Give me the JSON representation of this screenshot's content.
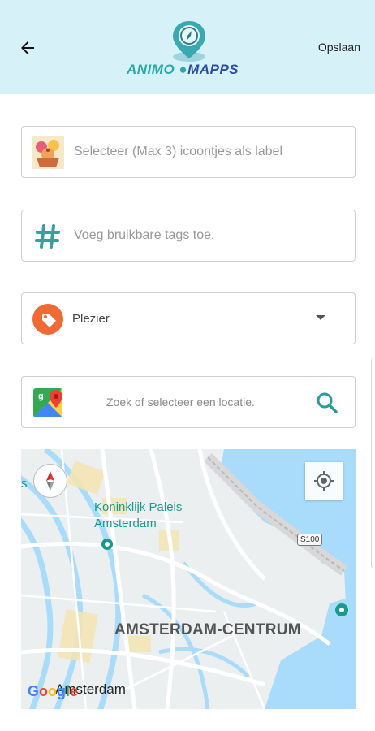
{
  "header": {
    "save_label": "Opslaan",
    "logo_text_part1": "ANIMO",
    "logo_text_part2": "MAPPS"
  },
  "form": {
    "icons_field": {
      "placeholder": "Selecteer (Max 3) icoontjes als label",
      "icon": "cupcake-icon"
    },
    "tags_field": {
      "placeholder": "Voeg bruikbare tags toe.",
      "icon": "hashtag-icon"
    },
    "category_field": {
      "selected": "Plezier",
      "icon": "tag-icon",
      "accent": "#f06a35"
    },
    "location_field": {
      "placeholder": "Zoek of selecteer een locatie.",
      "icon": "google-maps-icon",
      "search_icon": "search-icon",
      "accent": "#2a9d9b"
    }
  },
  "map": {
    "poi_name": "Koninklijk Paleis Amsterdam",
    "district": "AMSTERDAM-CENTRUM",
    "city": "Amsterdam",
    "road": "S100",
    "edge_letter": "s",
    "attribution": "Google",
    "colors": {
      "water": "#aadaff",
      "land": "#f0eeea",
      "roads": "#ffffff"
    }
  }
}
